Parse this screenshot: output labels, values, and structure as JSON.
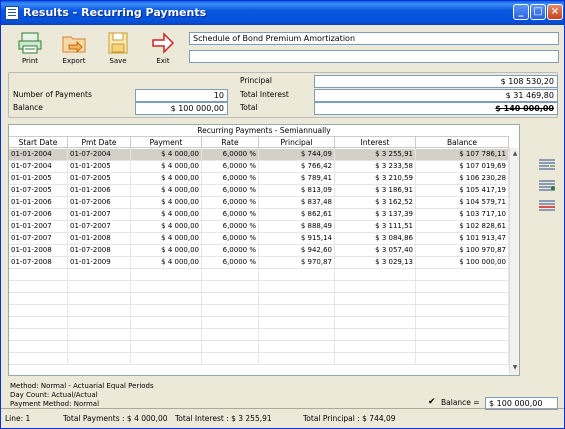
{
  "window": {
    "title": "Results - Recurring Payments"
  },
  "toolbar": {
    "print_label": "Print",
    "export_label": "Export",
    "save_label": "Save",
    "exit_label": "Exit"
  },
  "description": {
    "line1": "Schedule of Bond Premium Amortization",
    "line2": ""
  },
  "summary": {
    "number_of_payments_label": "Number of Payments",
    "number_of_payments": "10",
    "balance_label": "Balance",
    "balance": "$ 100 000,00",
    "principal_label": "Principal",
    "principal": "$ 108 530,20",
    "total_interest_label": "Total Interest",
    "total_interest": "$ 31 469,80",
    "total_label": "Total",
    "total": "$ 140 000,00"
  },
  "grid": {
    "caption": "Recurring Payments - Semiannually",
    "columns": [
      "Start Date",
      "Pmt Date",
      "Payment",
      "Rate",
      "Principal",
      "Interest",
      "Balance"
    ],
    "rows": [
      [
        "01-01-2004",
        "01-07-2004",
        "$ 4 000,00",
        "6,0000 %",
        "$ 744,09",
        "$ 3 255,91",
        "$ 107 786,11"
      ],
      [
        "01-07-2004",
        "01-01-2005",
        "$ 4 000,00",
        "6,0000 %",
        "$ 766,42",
        "$ 3 233,58",
        "$ 107 019,69"
      ],
      [
        "01-01-2005",
        "01-07-2005",
        "$ 4 000,00",
        "6,0000 %",
        "$ 789,41",
        "$ 3 210,59",
        "$ 106 230,28"
      ],
      [
        "01-07-2005",
        "01-01-2006",
        "$ 4 000,00",
        "6,0000 %",
        "$ 813,09",
        "$ 3 186,91",
        "$ 105 417,19"
      ],
      [
        "01-01-2006",
        "01-07-2006",
        "$ 4 000,00",
        "6,0000 %",
        "$ 837,48",
        "$ 3 162,52",
        "$ 104 579,71"
      ],
      [
        "01-07-2006",
        "01-01-2007",
        "$ 4 000,00",
        "6,0000 %",
        "$ 862,61",
        "$ 3 137,39",
        "$ 103 717,10"
      ],
      [
        "01-01-2007",
        "01-07-2007",
        "$ 4 000,00",
        "6,0000 %",
        "$ 888,49",
        "$ 3 111,51",
        "$ 102 828,61"
      ],
      [
        "01-07-2007",
        "01-01-2008",
        "$ 4 000,00",
        "6,0000 %",
        "$ 915,14",
        "$ 3 084,86",
        "$ 101 913,47"
      ],
      [
        "01-01-2008",
        "01-07-2008",
        "$ 4 000,00",
        "6,0000 %",
        "$ 942,60",
        "$ 3 057,40",
        "$ 100 970,87"
      ],
      [
        "01-07-2008",
        "01-01-2009",
        "$ 4 000,00",
        "6,0000 %",
        "$ 970,87",
        "$ 3 029,13",
        "$ 100 000,00"
      ]
    ]
  },
  "footer": {
    "method": "Method: Normal - Actuarial Equal Periods",
    "day_count": "Day Count: Actual/Actual",
    "payment_method": "Payment Method: Normal",
    "balance_label": "Balance =",
    "balance_value": "$ 100 000,00"
  },
  "status": {
    "line": "Line: 1",
    "total_payments": "Total Payments : $ 4 000,00",
    "total_interest": "Total Interest : $ 3 255,91",
    "total_principal": "Total Principal : $ 744,09"
  },
  "colors": {
    "titlebar": "#0758e0",
    "selected_row": "#d4d0c8",
    "exit_arrow": "#d42020"
  }
}
